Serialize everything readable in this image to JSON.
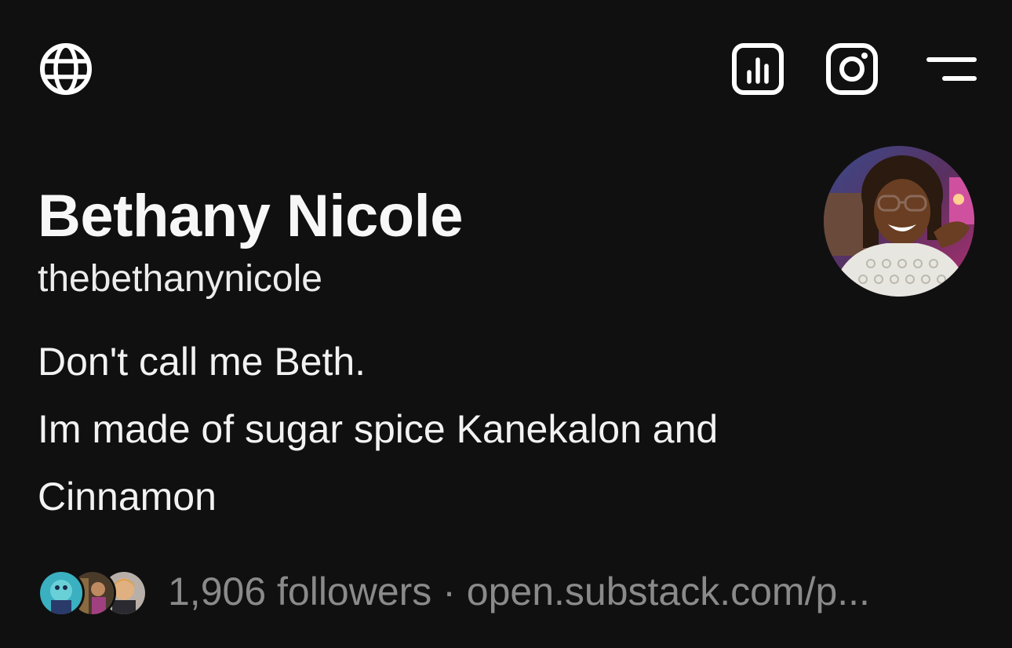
{
  "profile": {
    "name": "Bethany Nicole",
    "handle": "thebethanynicole",
    "bio_lines": [
      "Don't call me Beth.",
      "Im made of sugar spice Kanekalon and Cinnamon"
    ],
    "followers": "1,906 followers",
    "separator": "·",
    "link": "open.substack.com/p..."
  },
  "icons": {
    "globe": "globe-icon",
    "stats": "stats-icon",
    "instagram": "instagram-icon",
    "menu": "menu-icon"
  },
  "colors": {
    "background": "#101010",
    "text": "#f5f5f5",
    "muted": "#8a8a8a"
  }
}
